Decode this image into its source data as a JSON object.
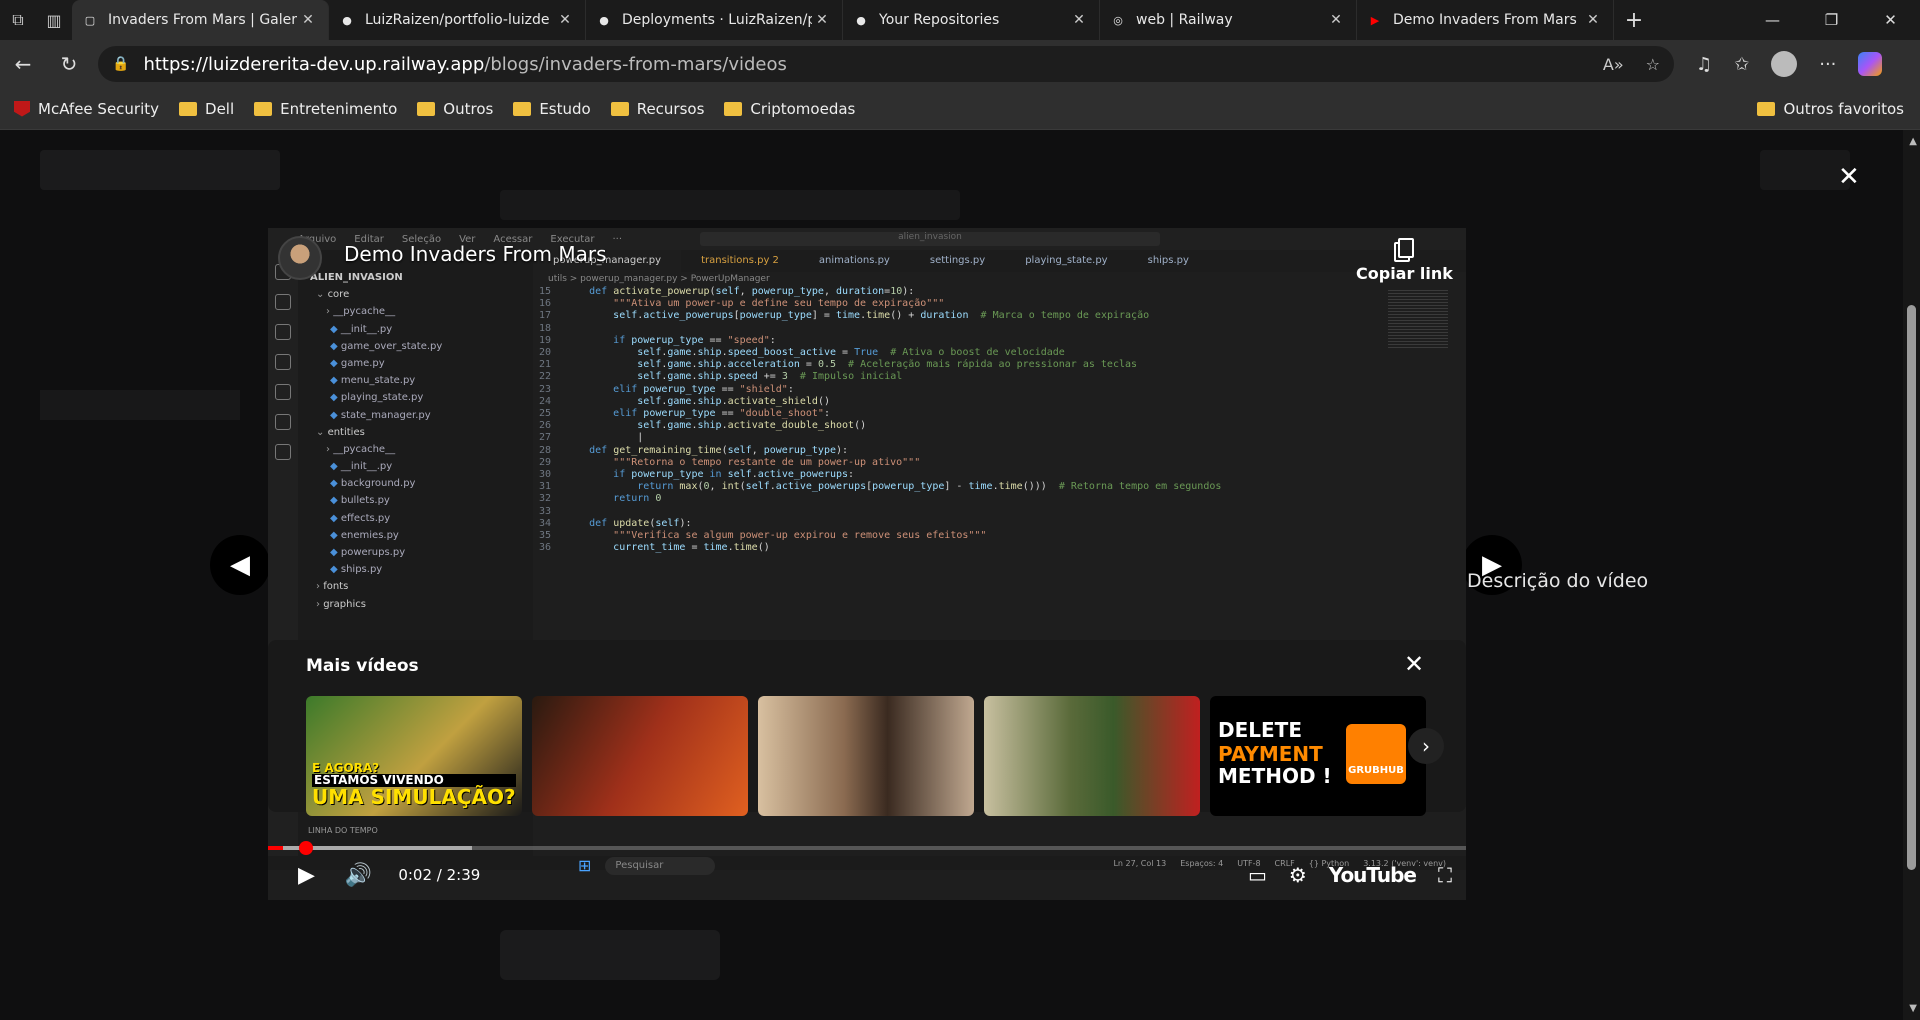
{
  "browser": {
    "tabs": [
      {
        "title": "Invaders From Mars | Galer",
        "active": true,
        "icon": "page-icon"
      },
      {
        "title": "LuizRaizen/portfolio-luizde",
        "active": false,
        "icon": "github-icon"
      },
      {
        "title": "Deployments · LuizRaizen/p",
        "active": false,
        "icon": "github-icon"
      },
      {
        "title": "Your Repositories",
        "active": false,
        "icon": "github-icon"
      },
      {
        "title": "web | Railway",
        "active": false,
        "icon": "railway-icon"
      },
      {
        "title": "Demo Invaders From Mars",
        "active": false,
        "icon": "youtube-icon"
      }
    ],
    "url_host": "https://luizdererita-dev.up.railway.app",
    "url_path": "/blogs/invaders-from-mars/videos",
    "bookmarks": [
      {
        "label": "McAfee Security",
        "icon": "mcafee-icon"
      },
      {
        "label": "Dell",
        "icon": "folder-icon"
      },
      {
        "label": "Entretenimento",
        "icon": "folder-icon"
      },
      {
        "label": "Outros",
        "icon": "folder-icon"
      },
      {
        "label": "Estudo",
        "icon": "folder-icon"
      },
      {
        "label": "Recursos",
        "icon": "folder-icon"
      },
      {
        "label": "Criptomoedas",
        "icon": "folder-icon"
      }
    ],
    "other_favorites": "Outros favoritos"
  },
  "player": {
    "title": "Demo Invaders From Mars",
    "copy_link": "Copiar link",
    "more_videos_title": "Mais vídeos",
    "current_time": "0:02 / 2:39",
    "progress_fraction": 0.0126,
    "buffered_fraction": 0.17,
    "logo": "YouTube",
    "thumbnails": [
      {
        "caption_lines": [
          "E AGORA?",
          "ESTAMOS VIVENDO",
          "UMA SIMULAÇÃO?"
        ]
      },
      {
        "caption_lines": []
      },
      {
        "caption_lines": []
      },
      {
        "caption_lines": []
      },
      {
        "caption_lines": [
          "DELETE",
          "PAYMENT",
          "METHOD !"
        ],
        "brand": "GRUBHUB"
      }
    ]
  },
  "gallery": {
    "description_label": "Descrição do vídeo"
  },
  "ide": {
    "menu": [
      "Arquivo",
      "Editar",
      "Seleção",
      "Ver",
      "Acessar",
      "Executar",
      "···"
    ],
    "search": "alien_invasion",
    "tabs": [
      "powerup_manager.py",
      "transitions.py 2",
      "animations.py",
      "settings.py",
      "playing_state.py",
      "ships.py"
    ],
    "breadcrumb": "utils > powerup_manager.py > PowerUpManager",
    "explorer_root": "ALIEN_INVASION",
    "explorer": [
      "core",
      "__pycache__",
      "__init__.py",
      "game_over_state.py",
      "game.py",
      "menu_state.py",
      "playing_state.py",
      "state_manager.py",
      "entities",
      "__pycache__",
      "__init__.py",
      "background.py",
      "bullets.py",
      "effects.py",
      "enemies.py",
      "powerups.py",
      "ships.py",
      "fonts",
      "graphics"
    ],
    "status": [
      "Ln 27, Col 13",
      "Espaços: 4",
      "UTF-8",
      "CRLF",
      "{} Python",
      "3.13.2 ('venv': venv)"
    ],
    "taskbar_search": "Pesquisar",
    "timeline": "LINHA DO TEMPO"
  }
}
